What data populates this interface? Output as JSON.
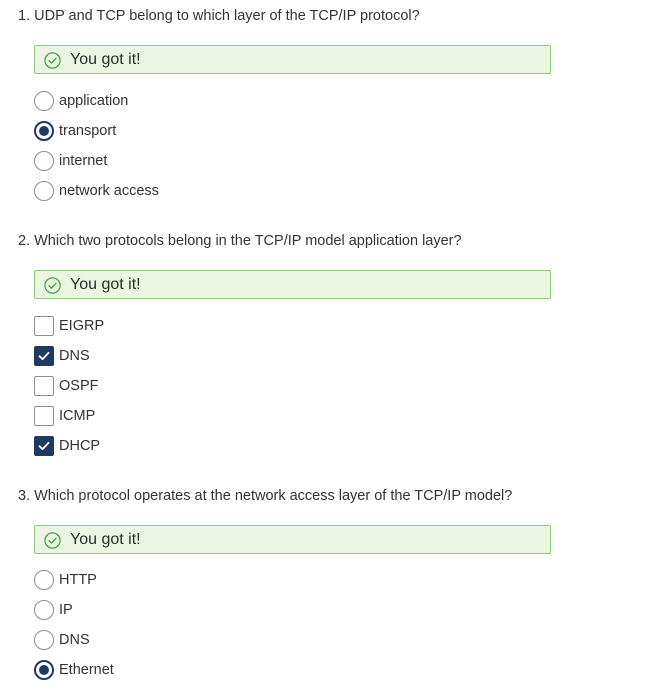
{
  "questions": [
    {
      "title": "1. UDP and TCP belong to which layer of the TCP/IP protocol?",
      "feedback": "You got it!",
      "type": "radio",
      "options": [
        {
          "label": "application",
          "selected": false
        },
        {
          "label": "transport",
          "selected": true
        },
        {
          "label": "internet",
          "selected": false
        },
        {
          "label": "network access",
          "selected": false
        }
      ]
    },
    {
      "title": "2. Which two protocols belong in the TCP/IP model application layer?",
      "feedback": "You got it!",
      "type": "checkbox",
      "options": [
        {
          "label": "EIGRP",
          "selected": false
        },
        {
          "label": "DNS",
          "selected": true
        },
        {
          "label": "OSPF",
          "selected": false
        },
        {
          "label": "ICMP",
          "selected": false
        },
        {
          "label": "DHCP",
          "selected": true
        }
      ]
    },
    {
      "title": "3. Which protocol operates at the network access layer of the TCP/IP model?",
      "feedback": "You got it!",
      "type": "radio",
      "options": [
        {
          "label": "HTTP",
          "selected": false
        },
        {
          "label": "IP",
          "selected": false
        },
        {
          "label": "DNS",
          "selected": false
        },
        {
          "label": "Ethernet",
          "selected": true
        }
      ]
    }
  ],
  "colors": {
    "feedback_background": "#eaf6e1",
    "feedback_border": "#8fc77c",
    "success_icon": "#4aa848",
    "selected_control": "#1f3a5f"
  },
  "icons": {
    "feedback_icon": "check-circle-icon",
    "checked_icon": "checkmark-icon"
  }
}
